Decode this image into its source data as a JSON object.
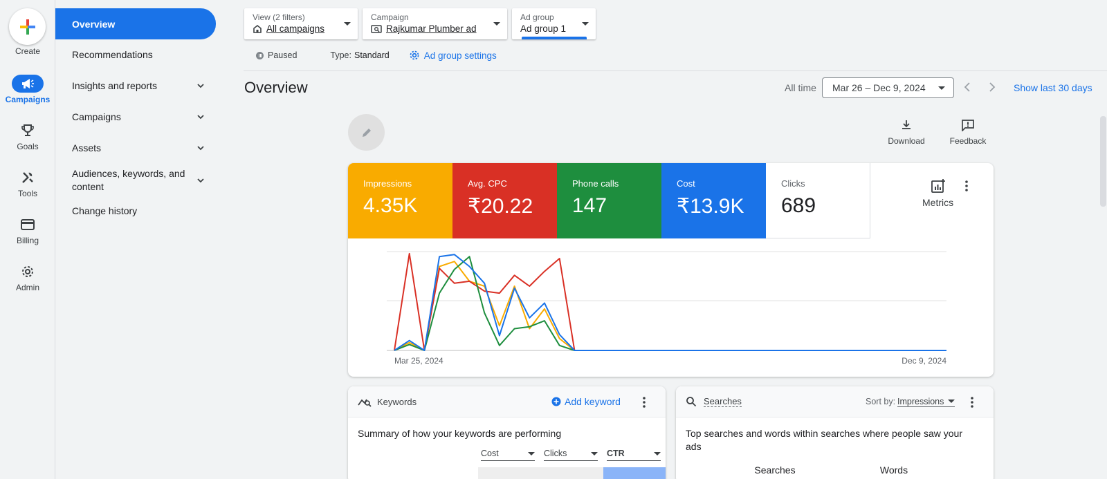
{
  "rail": {
    "create_label": "Create",
    "items": [
      {
        "label": "Campaigns",
        "icon": "megaphone-icon"
      },
      {
        "label": "Goals",
        "icon": "trophy-icon"
      },
      {
        "label": "Tools",
        "icon": "tools-icon"
      },
      {
        "label": "Billing",
        "icon": "credit-card-icon"
      },
      {
        "label": "Admin",
        "icon": "gear-icon"
      }
    ]
  },
  "sidebar": {
    "items": [
      {
        "label": "Overview"
      },
      {
        "label": "Recommendations"
      },
      {
        "label": "Insights and reports"
      },
      {
        "label": "Campaigns"
      },
      {
        "label": "Assets"
      },
      {
        "label": "Audiences, keywords, and content"
      },
      {
        "label": "Change history"
      }
    ]
  },
  "filters": {
    "view": {
      "label": "View (2 filters)",
      "value": "All campaigns"
    },
    "campaign": {
      "label": "Campaign",
      "value": "Rajkumar Plumber ad"
    },
    "adgroup": {
      "label": "Ad group",
      "value": "Ad group 1"
    }
  },
  "status": {
    "state": "Paused",
    "type_label": "Type:",
    "type_value": "Standard",
    "settings_link": "Ad group settings"
  },
  "header": {
    "title": "Overview",
    "alltime": "All time",
    "date_range": "Mar 26 – Dec 9, 2024",
    "show_last": "Show last 30 days"
  },
  "actions": {
    "download": "Download",
    "feedback": "Feedback"
  },
  "tiles": [
    {
      "label": "Impressions",
      "value": "4.35K",
      "color": "#f9ab00"
    },
    {
      "label": "Avg. CPC",
      "value": "₹20.22",
      "color": "#d93025"
    },
    {
      "label": "Phone calls",
      "value": "147",
      "color": "#1e8e3e"
    },
    {
      "label": "Cost",
      "value": "₹13.9K",
      "color": "#1a73e8"
    },
    {
      "label": "Clicks",
      "value": "689",
      "color": "#ffffff"
    }
  ],
  "metrics_label": "Metrics",
  "chart_data": {
    "type": "line",
    "x_start_label": "Mar 25, 2024",
    "x_end_label": "Dec 9, 2024",
    "grid": true,
    "points_n": 14,
    "series": [
      {
        "name": "Impressions",
        "color": "#f9ab00",
        "values": [
          0,
          0.08,
          0,
          0.85,
          0.9,
          0.7,
          0.65,
          0.25,
          0.65,
          0.22,
          0.42,
          0.12,
          0,
          0
        ]
      },
      {
        "name": "Avg. CPC",
        "color": "#d93025",
        "values": [
          0,
          0.98,
          0,
          0.83,
          0.68,
          0.7,
          0.6,
          0.58,
          0.76,
          0.65,
          0.8,
          0.93,
          0,
          0
        ]
      },
      {
        "name": "Phone calls",
        "color": "#1e8e3e",
        "values": [
          0,
          0.06,
          0,
          0.58,
          0.82,
          0.95,
          0.38,
          0.05,
          0.22,
          0.24,
          0.3,
          0.05,
          0,
          0
        ]
      },
      {
        "name": "Cost",
        "color": "#1a73e8",
        "values": [
          0,
          0.1,
          0,
          0.95,
          0.97,
          0.85,
          0.68,
          0.15,
          0.63,
          0.33,
          0.48,
          0.16,
          0,
          0
        ]
      }
    ]
  },
  "keywords": {
    "title": "Keywords",
    "add": "Add keyword",
    "summary": "Summary of how your keywords are performing",
    "columns": [
      "Cost",
      "Clicks",
      "CTR"
    ]
  },
  "searches": {
    "title": "Searches",
    "sort_label": "Sort by:",
    "sort_value": "Impressions",
    "summary": "Top searches and words within searches where people saw your ads",
    "tabs": [
      "Searches",
      "Words"
    ]
  }
}
